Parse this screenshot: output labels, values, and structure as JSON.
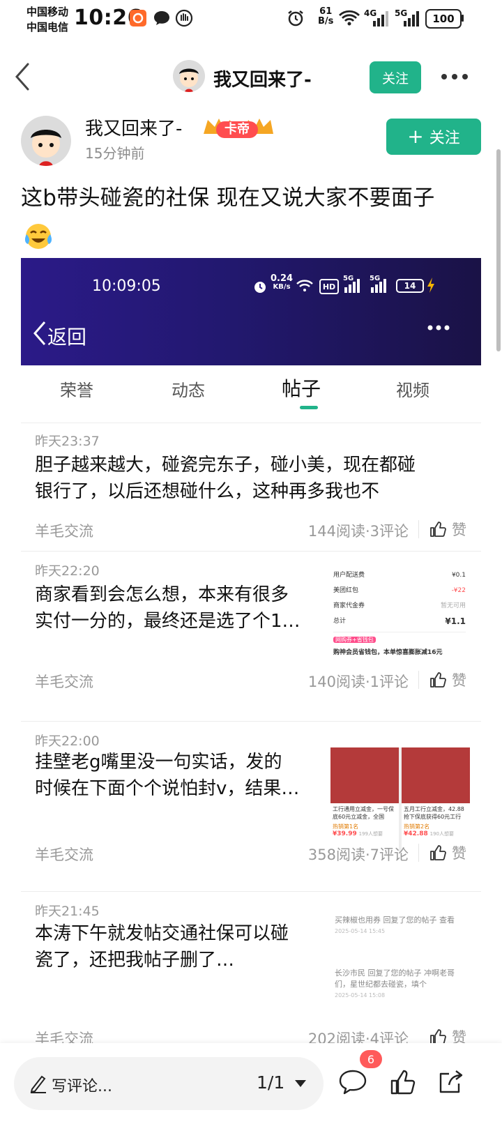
{
  "status_bar": {
    "carrier1": "中国移动",
    "carrier2": "中国电信",
    "time": "10:26",
    "net_speed_value": "61",
    "net_speed_unit": "B/s",
    "signal1": "4G",
    "signal2": "5G",
    "battery": "100"
  },
  "nav": {
    "title": "我又回来了-",
    "follow_label": "关注"
  },
  "post": {
    "author": "我又回来了-",
    "badge_label": "卡帝",
    "time_ago": "15分钟前",
    "follow_label": "关注",
    "text": "这b带头碰瓷的社保 现在又说大家不要面子",
    "emoji": "😭"
  },
  "screenshot": {
    "time": "10:09:05",
    "net_speed_value": "0.24",
    "net_speed_unit": "KB/s",
    "hd": "HD",
    "signal1": "5G",
    "signal2": "5G",
    "battery": "14",
    "back_label": "返回"
  },
  "tabs": [
    {
      "label": "荣誉",
      "active": false
    },
    {
      "label": "动态",
      "active": false
    },
    {
      "label": "帖子",
      "active": true
    },
    {
      "label": "视频",
      "active": false
    }
  ],
  "items": [
    {
      "time": "昨天23:37",
      "line1": "胆子越来越大，碰瓷完东子，碰小美，现在都碰",
      "line2": "银行了，以后还想碰什么，这种再多我也不",
      "source": "羊毛交流",
      "stats": "144阅读·3评论",
      "like_label": "赞"
    },
    {
      "time": "昨天22:20",
      "line1": "商家看到会怎么想，本来有很多",
      "line2": "实付一分的，最终还是选了个1…",
      "source": "羊毛交流",
      "stats": "140阅读·1评论",
      "like_label": "赞",
      "thumb": {
        "rows": [
          "用户配送费",
          "美团红包",
          "商家代金券",
          "总计"
        ],
        "prices": [
          "¥0.1",
          "-¥22",
          "暂无可用",
          "¥1.1"
        ],
        "promo_tag": "网购券+省钱包",
        "promo": "购神会员省钱包，本单惊喜膨胀减16元"
      }
    },
    {
      "time": "昨天22:00",
      "line1": "挂壁老g嘴里没一句实话，发的",
      "line2": "时候在下面个个说怕封v，结果…",
      "source": "羊毛交流",
      "stats": "358阅读·7评论",
      "like_label": "赞",
      "thumb": {
        "left_text": "工行通用立减金，一号保底60元立减金，全国",
        "left_rank": "热销第1名",
        "left_price": "¥39.99",
        "left_sold": "199人想要",
        "right_text": "五月工行立减金，42.88抢下保底获得60元工行",
        "right_rank": "热销第2名",
        "right_price": "¥42.88",
        "right_sold": "190人想要"
      }
    },
    {
      "time": "昨天21:45",
      "line1": "本涛下午就发帖交通社保可以碰",
      "line2": "瓷了，还把我帖子删了…",
      "source": "羊毛交流",
      "stats": "202阅读·4评论",
      "like_label": "赞",
      "thumb": {
        "n1_text": "买辣椒也用券 回复了您的帖子 查看",
        "n1_time": "2025-05-14 15:45",
        "n2_text": "长沙市民 回复了您的帖子 冲啊老哥们，星世纪都去碰瓷，填个",
        "n2_time": "2025-05-14 15:08"
      }
    }
  ],
  "bottom": {
    "comment_placeholder": "写评论...",
    "page": "1/1",
    "comment_count": "6"
  },
  "colors": {
    "accent": "#21b38a",
    "badge_red": "#ff4d4f"
  }
}
